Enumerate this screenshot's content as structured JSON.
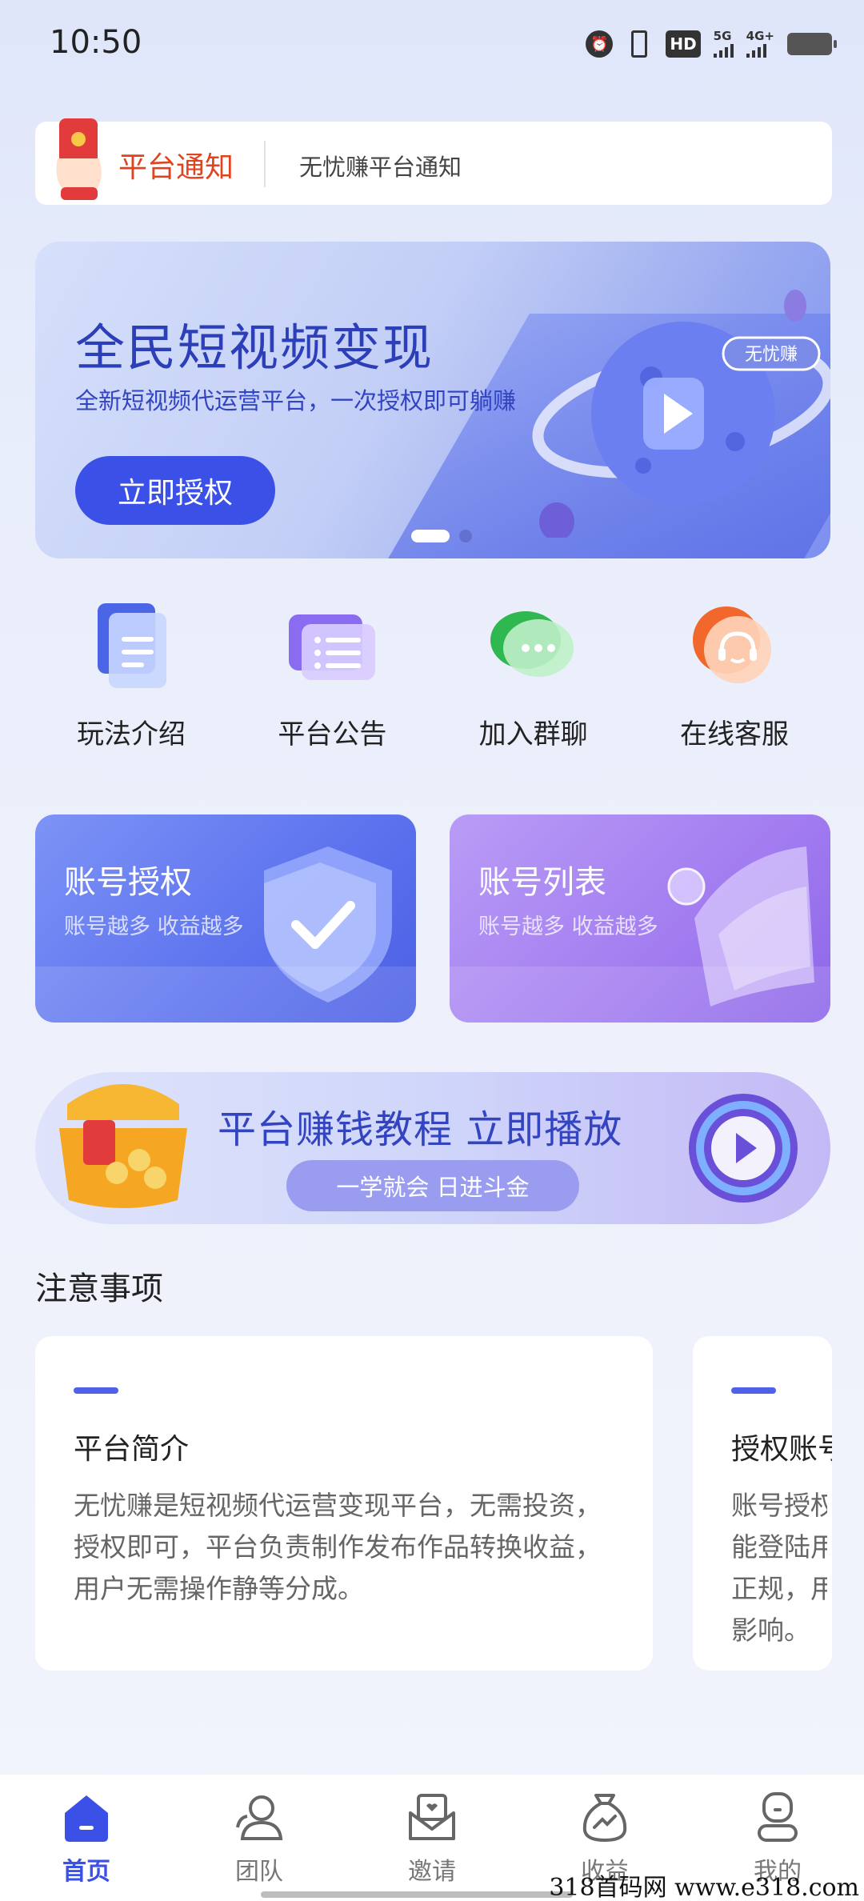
{
  "status_bar": {
    "time": "10:50",
    "hd": "HD",
    "net1": "5G",
    "net2": "4G+"
  },
  "notice": {
    "title": "平台通知",
    "text": "无忧赚平台通知"
  },
  "banner": {
    "title": "全民短视频变现",
    "subtitle": "全新短视频代运营平台，一次授权即可躺赚",
    "button": "立即授权",
    "badge": "无忧赚",
    "page_count": 2,
    "active_page": 1
  },
  "quick_actions": [
    {
      "label": "玩法介绍",
      "icon": "doc-icon"
    },
    {
      "label": "平台公告",
      "icon": "list-icon"
    },
    {
      "label": "加入群聊",
      "icon": "chat-icon"
    },
    {
      "label": "在线客服",
      "icon": "headset-icon"
    }
  ],
  "features": [
    {
      "title": "账号授权",
      "subtitle": "账号越多 收益越多"
    },
    {
      "title": "账号列表",
      "subtitle": "账号越多 收益越多"
    }
  ],
  "tutorial": {
    "title": "平台赚钱教程 立即播放",
    "tagline": "一学就会 日进斗金"
  },
  "notes": {
    "section_title": "注意事项",
    "cards": [
      {
        "title": "平台简介",
        "body": "无忧赚是短视频代运营变现平台，无需投资，授权即可，平台负责制作发布作品转换收益，用户无需操作静等分成。"
      },
      {
        "title": "授权账号",
        "body_lines": [
          "账号授权",
          "能登陆用",
          "正规，用",
          "影响。"
        ]
      }
    ]
  },
  "bottom_nav": [
    {
      "label": "首页",
      "icon": "home-icon",
      "active": true
    },
    {
      "label": "团队",
      "icon": "team-icon",
      "active": false
    },
    {
      "label": "邀请",
      "icon": "invite-icon",
      "active": false
    },
    {
      "label": "收益",
      "icon": "earnings-icon",
      "active": false
    },
    {
      "label": "我的",
      "icon": "profile-icon",
      "active": false
    }
  ],
  "watermark": "318首码网 www.e318.com",
  "colors": {
    "primary": "#3b50e6",
    "notice_red": "#e0431e",
    "title_blue": "#2c3fb8"
  }
}
